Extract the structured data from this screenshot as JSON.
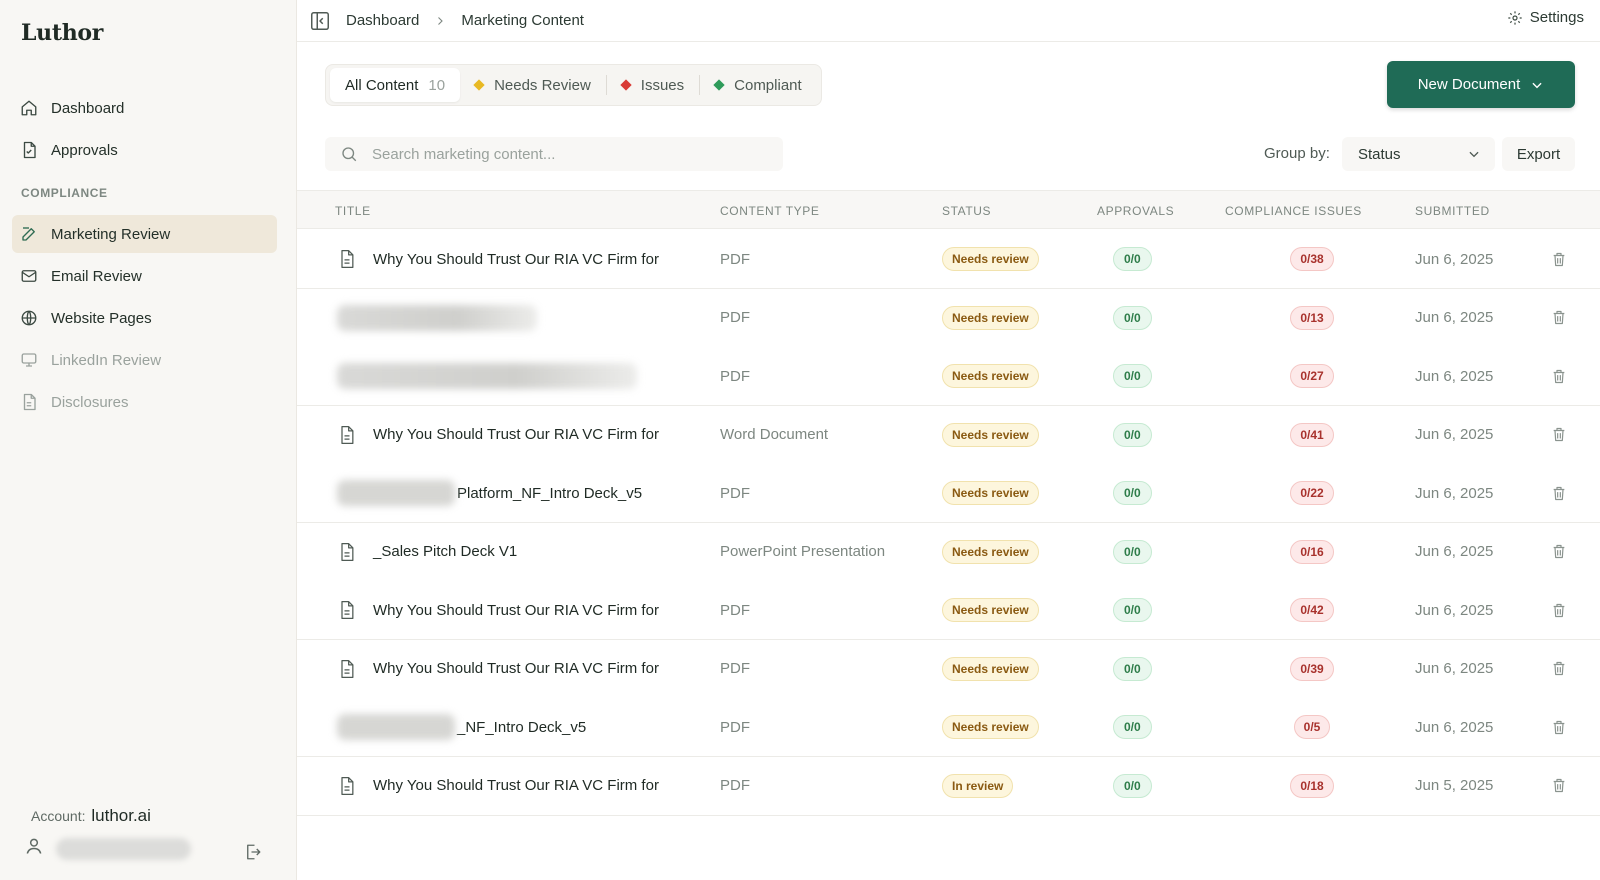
{
  "app": {
    "logo": "Luthor"
  },
  "sidebar": {
    "items_top": [
      {
        "label": "Dashboard",
        "icon": "home-icon"
      },
      {
        "label": "Approvals",
        "icon": "file-check-icon"
      }
    ],
    "section_label": "COMPLIANCE",
    "items_compliance": [
      {
        "label": "Marketing Review",
        "icon": "edit-icon",
        "active": true
      },
      {
        "label": "Email Review",
        "icon": "mail-icon"
      },
      {
        "label": "Website Pages",
        "icon": "globe-icon"
      },
      {
        "label": "LinkedIn Review",
        "icon": "monitor-icon",
        "muted": true
      },
      {
        "label": "Disclosures",
        "icon": "document-icon",
        "muted": true
      }
    ],
    "account_label": "Account:",
    "account_name": "luthor.ai"
  },
  "header": {
    "breadcrumb": [
      "Dashboard",
      "Marketing Content"
    ],
    "settings_label": "Settings"
  },
  "tabs": [
    {
      "label": "All Content",
      "count": "10",
      "active": true
    },
    {
      "label": "Needs Review",
      "dot_color": "#e8b923"
    },
    {
      "label": "Issues",
      "dot_color": "#d93a35"
    },
    {
      "label": "Compliant",
      "dot_color": "#2e9b5a"
    }
  ],
  "new_document_label": "New Document",
  "search": {
    "placeholder": "Search marketing content..."
  },
  "group_by": {
    "label": "Group by:",
    "value": "Status"
  },
  "export_label": "Export",
  "table": {
    "columns": [
      "TITLE",
      "CONTENT TYPE",
      "STATUS",
      "APPROVALS",
      "COMPLIANCE ISSUES",
      "SUBMITTED"
    ],
    "rows": [
      {
        "title": "Why You Should Trust Our RIA VC Firm for",
        "type": "PDF",
        "status": "Needs review",
        "approvals": "0/0",
        "issues": "0/38",
        "submitted": "Jun 6, 2025"
      },
      {
        "title": "",
        "title_blurred": true,
        "type": "PDF",
        "status": "Needs review",
        "approvals": "0/0",
        "issues": "0/13",
        "submitted": "Jun 6, 2025"
      },
      {
        "title": "",
        "title_blurred": true,
        "type": "PDF",
        "status": "Needs review",
        "approvals": "0/0",
        "issues": "0/27",
        "submitted": "Jun 6, 2025"
      },
      {
        "title": "Why You Should Trust Our RIA VC Firm for",
        "type": "Word Document",
        "status": "Needs review",
        "approvals": "0/0",
        "issues": "0/41",
        "submitted": "Jun 6, 2025"
      },
      {
        "title": "Platform_NF_Intro Deck_v5",
        "title_prefix_blurred": true,
        "type": "PDF",
        "status": "Needs review",
        "approvals": "0/0",
        "issues": "0/22",
        "submitted": "Jun 6, 2025"
      },
      {
        "title": "_Sales Pitch Deck V1",
        "type": "PowerPoint Presentation",
        "status": "Needs review",
        "approvals": "0/0",
        "issues": "0/16",
        "submitted": "Jun 6, 2025"
      },
      {
        "title": "Why You Should Trust Our RIA VC Firm for",
        "type": "PDF",
        "status": "Needs review",
        "approvals": "0/0",
        "issues": "0/42",
        "submitted": "Jun 6, 2025"
      },
      {
        "title": "Why You Should Trust Our RIA VC Firm for",
        "type": "PDF",
        "status": "Needs review",
        "approvals": "0/0",
        "issues": "0/39",
        "submitted": "Jun 6, 2025"
      },
      {
        "title": "_NF_Intro Deck_v5",
        "title_prefix_blurred": true,
        "type": "PDF",
        "status": "Needs review",
        "approvals": "0/0",
        "issues": "0/5",
        "submitted": "Jun 6, 2025"
      },
      {
        "title": "Why You Should Trust Our RIA VC Firm for",
        "type": "PDF",
        "status": "In review",
        "approvals": "0/0",
        "issues": "0/18",
        "submitted": "Jun 5, 2025"
      }
    ]
  }
}
